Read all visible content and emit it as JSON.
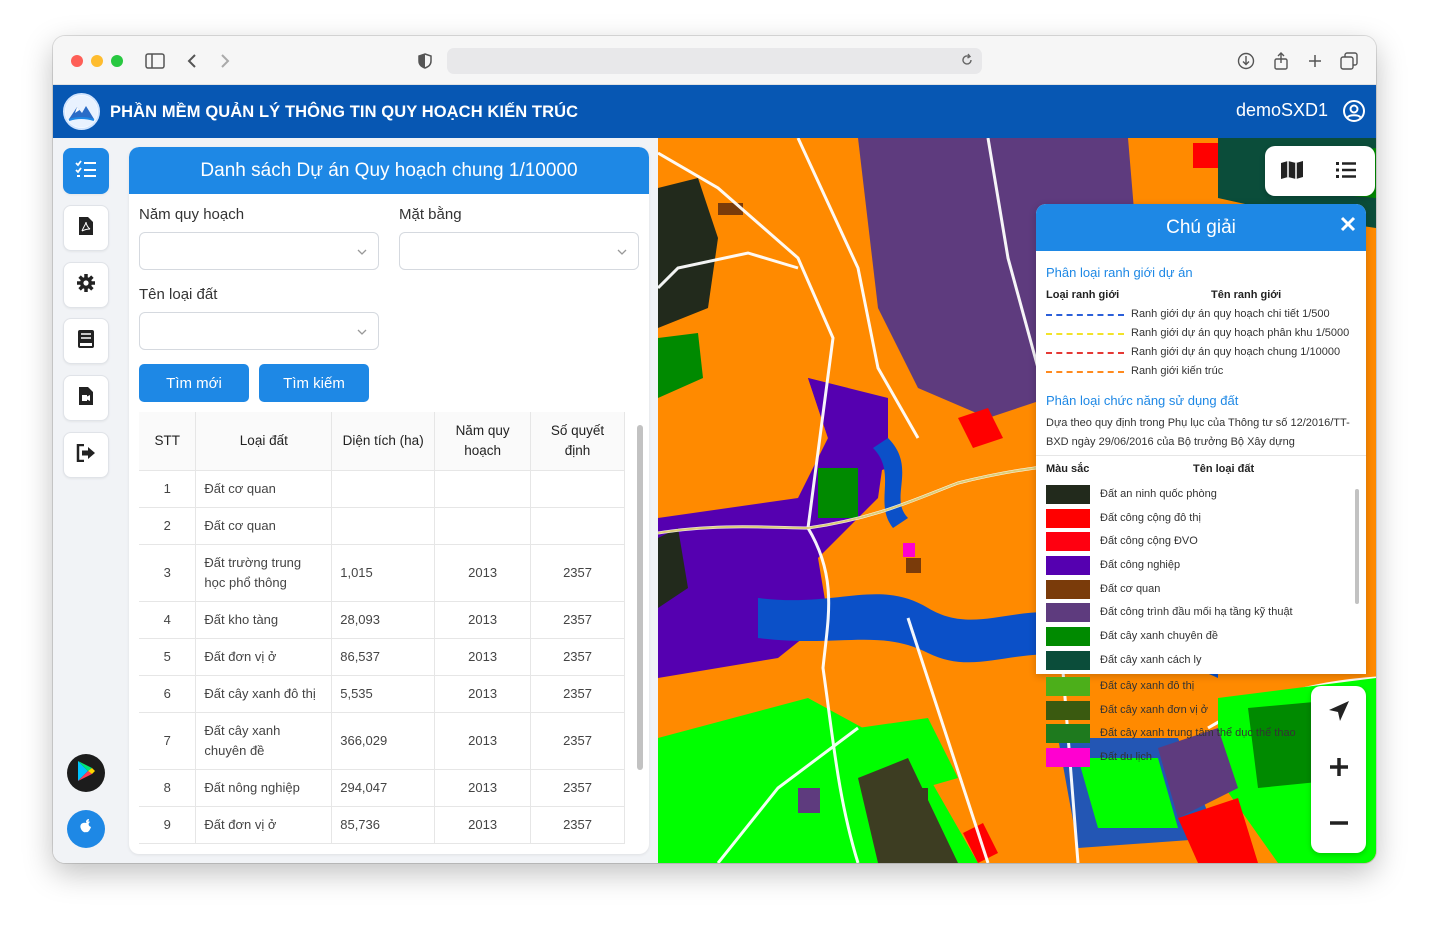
{
  "app": {
    "title": "PHẦN MỀM QUẢN LÝ THÔNG TIN QUY HOẠCH KIẾN TRÚC",
    "user": "demoSXD1"
  },
  "panel": {
    "title": "Danh sách Dự án Quy hoạch chung 1/10000",
    "filters": {
      "year_label": "Năm quy hoạch",
      "year_value": "",
      "plan_label": "Mặt bằng",
      "plan_value": "",
      "land_label": "Tên loại đất",
      "land_value": ""
    },
    "buttons": {
      "reset": "Tìm mới",
      "search": "Tìm kiếm"
    },
    "table": {
      "headers": [
        "STT",
        "Loại đất",
        "Diện tích (ha)",
        "Năm quy hoạch",
        "Số quyết định"
      ],
      "rows": [
        {
          "stt": "1",
          "type": "Đất cơ quan",
          "area": "",
          "year": "",
          "decision": ""
        },
        {
          "stt": "2",
          "type": "Đất cơ quan",
          "area": "",
          "year": "",
          "decision": ""
        },
        {
          "stt": "3",
          "type": "Đất trường trung học phổ thông",
          "area": "1,015",
          "year": "2013",
          "decision": "2357"
        },
        {
          "stt": "4",
          "type": "Đất kho tàng",
          "area": "28,093",
          "year": "2013",
          "decision": "2357"
        },
        {
          "stt": "5",
          "type": "Đất đơn vị ở",
          "area": "86,537",
          "year": "2013",
          "decision": "2357"
        },
        {
          "stt": "6",
          "type": "Đất cây xanh đô thị",
          "area": "5,535",
          "year": "2013",
          "decision": "2357"
        },
        {
          "stt": "7",
          "type": "Đất cây xanh chuyên đề",
          "area": "366,029",
          "year": "2013",
          "decision": "2357"
        },
        {
          "stt": "8",
          "type": "Đất nông nghiệp",
          "area": "294,047",
          "year": "2013",
          "decision": "2357"
        },
        {
          "stt": "9",
          "type": "Đất đơn vị ở",
          "area": "85,736",
          "year": "2013",
          "decision": "2357"
        }
      ]
    }
  },
  "legend": {
    "title": "Chú giải",
    "boundary_section": "Phân loại ranh giới dự án",
    "boundary_col1": "Loại ranh giới",
    "boundary_col2": "Tên ranh giới",
    "boundaries": [
      {
        "name": "Ranh giới dự án quy hoạch chi tiết 1/500",
        "color": "#2b5fd9"
      },
      {
        "name": "Ranh giới dự án quy hoạch phân khu 1/5000",
        "color": "#f2e32a"
      },
      {
        "name": "Ranh giới dự án quy hoạch chung 1/10000",
        "color": "#e53935"
      },
      {
        "name": "Ranh giới kiến trúc",
        "color": "#ff8a1e"
      }
    ],
    "landuse_section": "Phân loại chức năng sử dụng đất",
    "landuse_note": "Dựa theo quy định trong Phụ lục của Thông tư số 12/2016/TT-BXD ngày 29/06/2016 của Bộ trưởng Bộ Xây dựng",
    "landuse_col1": "Màu sắc",
    "landuse_col2": "Tên loại đất",
    "landuse": [
      {
        "name": "Đất an ninh quốc phòng",
        "color": "#222a1c"
      },
      {
        "name": "Đất công cộng đô thị",
        "color": "#ff0000"
      },
      {
        "name": "Đất công cộng ĐVO",
        "color": "#ff0010"
      },
      {
        "name": "Đất công nghiệp",
        "color": "#5500b0"
      },
      {
        "name": "Đất cơ quan",
        "color": "#7a3b0a"
      },
      {
        "name": "Đất công trình đầu mối hạ tầng kỹ thuật",
        "color": "#5e3b7e"
      },
      {
        "name": "Đất cây xanh chuyên đề",
        "color": "#008a00"
      },
      {
        "name": "Đất cây xanh cách ly",
        "color": "#0b4d3a"
      }
    ],
    "landuse_overflow": [
      {
        "name": "Đất cây xanh đô thị",
        "color": "#4caf1a"
      },
      {
        "name": "Đất cây xanh đơn vị ở",
        "color": "#3a5a10"
      },
      {
        "name": "Đất cây xanh trung tâm thể dục thể thao",
        "color": "#1e7a1e"
      },
      {
        "name": "Đất du lịch",
        "color": "#ff00d0"
      }
    ]
  },
  "icons": {
    "sidebar": [
      "list-icon",
      "pdf-file-icon",
      "gear-icon",
      "book-icon",
      "document-icon",
      "logout-icon"
    ],
    "stores": [
      "google-play-icon",
      "apple-icon"
    ],
    "map": [
      "map-icon",
      "list-icon",
      "locate-icon",
      "zoom-in-icon",
      "zoom-out-icon"
    ]
  }
}
